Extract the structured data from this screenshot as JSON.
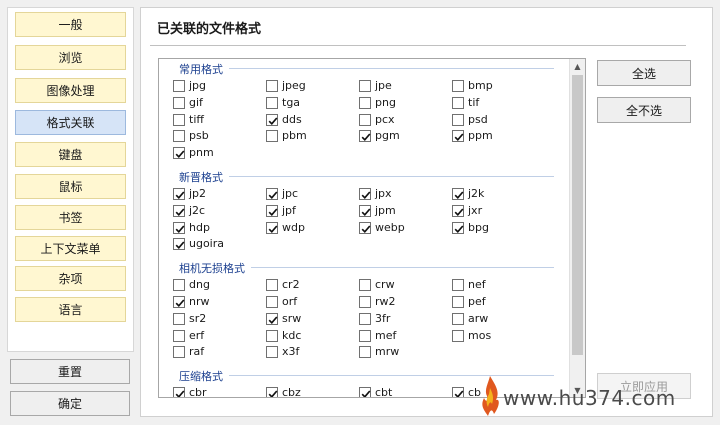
{
  "sidebar": {
    "items": [
      {
        "label": "一般"
      },
      {
        "label": "浏览"
      },
      {
        "label": "图像处理"
      },
      {
        "label": "格式关联"
      },
      {
        "label": "键盘"
      },
      {
        "label": "鼠标"
      },
      {
        "label": "书签"
      },
      {
        "label": "上下文菜单"
      },
      {
        "label": "杂项"
      },
      {
        "label": "语言"
      }
    ],
    "selected_index": 3
  },
  "bottom_buttons": {
    "reset": "重置",
    "ok": "确定"
  },
  "main": {
    "title": "已关联的文件格式",
    "groups": [
      {
        "title": "常用格式",
        "items": [
          {
            "label": "jpg",
            "checked": false
          },
          {
            "label": "jpeg",
            "checked": false
          },
          {
            "label": "jpe",
            "checked": false
          },
          {
            "label": "bmp",
            "checked": false
          },
          {
            "label": "gif",
            "checked": false
          },
          {
            "label": "tga",
            "checked": false
          },
          {
            "label": "png",
            "checked": false
          },
          {
            "label": "tif",
            "checked": false
          },
          {
            "label": "tiff",
            "checked": false
          },
          {
            "label": "dds",
            "checked": true
          },
          {
            "label": "pcx",
            "checked": false
          },
          {
            "label": "psd",
            "checked": false
          },
          {
            "label": "psb",
            "checked": false
          },
          {
            "label": "pbm",
            "checked": false
          },
          {
            "label": "pgm",
            "checked": true
          },
          {
            "label": "ppm",
            "checked": true
          },
          {
            "label": "pnm",
            "checked": true
          }
        ]
      },
      {
        "title": "新晋格式",
        "items": [
          {
            "label": "jp2",
            "checked": true
          },
          {
            "label": "jpc",
            "checked": true
          },
          {
            "label": "jpx",
            "checked": true
          },
          {
            "label": "j2k",
            "checked": true
          },
          {
            "label": "j2c",
            "checked": true
          },
          {
            "label": "jpf",
            "checked": true
          },
          {
            "label": "jpm",
            "checked": true
          },
          {
            "label": "jxr",
            "checked": true
          },
          {
            "label": "hdp",
            "checked": true
          },
          {
            "label": "wdp",
            "checked": true
          },
          {
            "label": "webp",
            "checked": true
          },
          {
            "label": "bpg",
            "checked": true
          },
          {
            "label": "ugoira",
            "checked": true
          }
        ]
      },
      {
        "title": "相机无损格式",
        "items": [
          {
            "label": "dng",
            "checked": false
          },
          {
            "label": "cr2",
            "checked": false
          },
          {
            "label": "crw",
            "checked": false
          },
          {
            "label": "nef",
            "checked": false
          },
          {
            "label": "nrw",
            "checked": true
          },
          {
            "label": "orf",
            "checked": false
          },
          {
            "label": "rw2",
            "checked": false
          },
          {
            "label": "pef",
            "checked": false
          },
          {
            "label": "sr2",
            "checked": false
          },
          {
            "label": "srw",
            "checked": true
          },
          {
            "label": "3fr",
            "checked": false
          },
          {
            "label": "arw",
            "checked": false
          },
          {
            "label": "erf",
            "checked": false
          },
          {
            "label": "kdc",
            "checked": false
          },
          {
            "label": "mef",
            "checked": false
          },
          {
            "label": "mos",
            "checked": false
          },
          {
            "label": "raf",
            "checked": false
          },
          {
            "label": "x3f",
            "checked": false
          },
          {
            "label": "mrw",
            "checked": false
          }
        ]
      },
      {
        "title": "压缩格式",
        "items": [
          {
            "label": "cbr",
            "checked": true
          },
          {
            "label": "cbz",
            "checked": true
          },
          {
            "label": "cbt",
            "checked": true
          },
          {
            "label": "cb",
            "checked": true
          }
        ]
      }
    ]
  },
  "buttons": {
    "select_all": "全选",
    "select_none": "全不选",
    "apply_now": "立即应用"
  },
  "watermark": "www.hu374.com"
}
